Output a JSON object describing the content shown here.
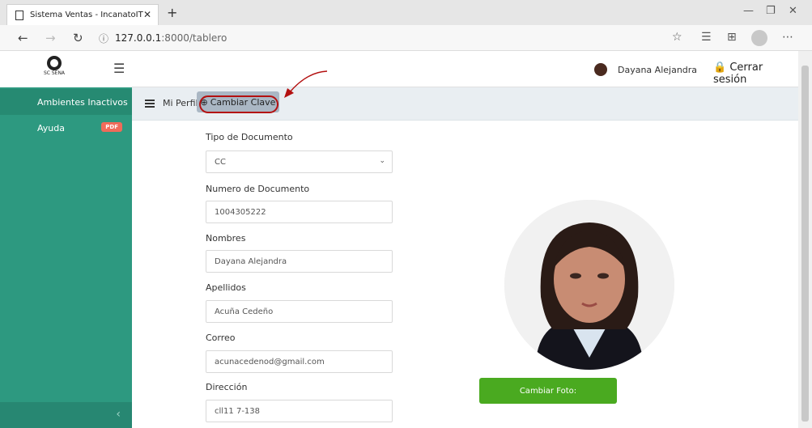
{
  "browser": {
    "tab_title": "Sistema Ventas - IncanatoIT",
    "url_host": "127.0.0.1",
    "url_rest": ":8000/tablero"
  },
  "header": {
    "user_name": "Dayana Alejandra",
    "logout_label": "Cerrar sesión",
    "logo_text": "SC SENA"
  },
  "sidebar": {
    "items": [
      {
        "label": "Ambientes Inactivos"
      },
      {
        "label": "Ayuda",
        "badge": "PDF"
      }
    ]
  },
  "subbar": {
    "profile_label": "Mi Perfil",
    "change_pass_label": "Cambiar Clave"
  },
  "form": {
    "doc_type_label": "Tipo de Documento",
    "doc_type_value": "CC",
    "doc_number_label": "Numero de Documento",
    "doc_number_value": "1004305222",
    "names_label": "Nombres",
    "names_value": "Dayana Alejandra",
    "surnames_label": "Apellidos",
    "surnames_value": "Acuña Cedeño",
    "email_label": "Correo",
    "email_value": "acunacedenod@gmail.com",
    "address_label": "Dirección",
    "address_value": "cll11 7-138"
  },
  "photo": {
    "button_label": "Cambiar Foto:"
  },
  "colors": {
    "sidebar": "#2d9980",
    "photo_button": "#4aaa20",
    "annotation": "#b31010"
  }
}
